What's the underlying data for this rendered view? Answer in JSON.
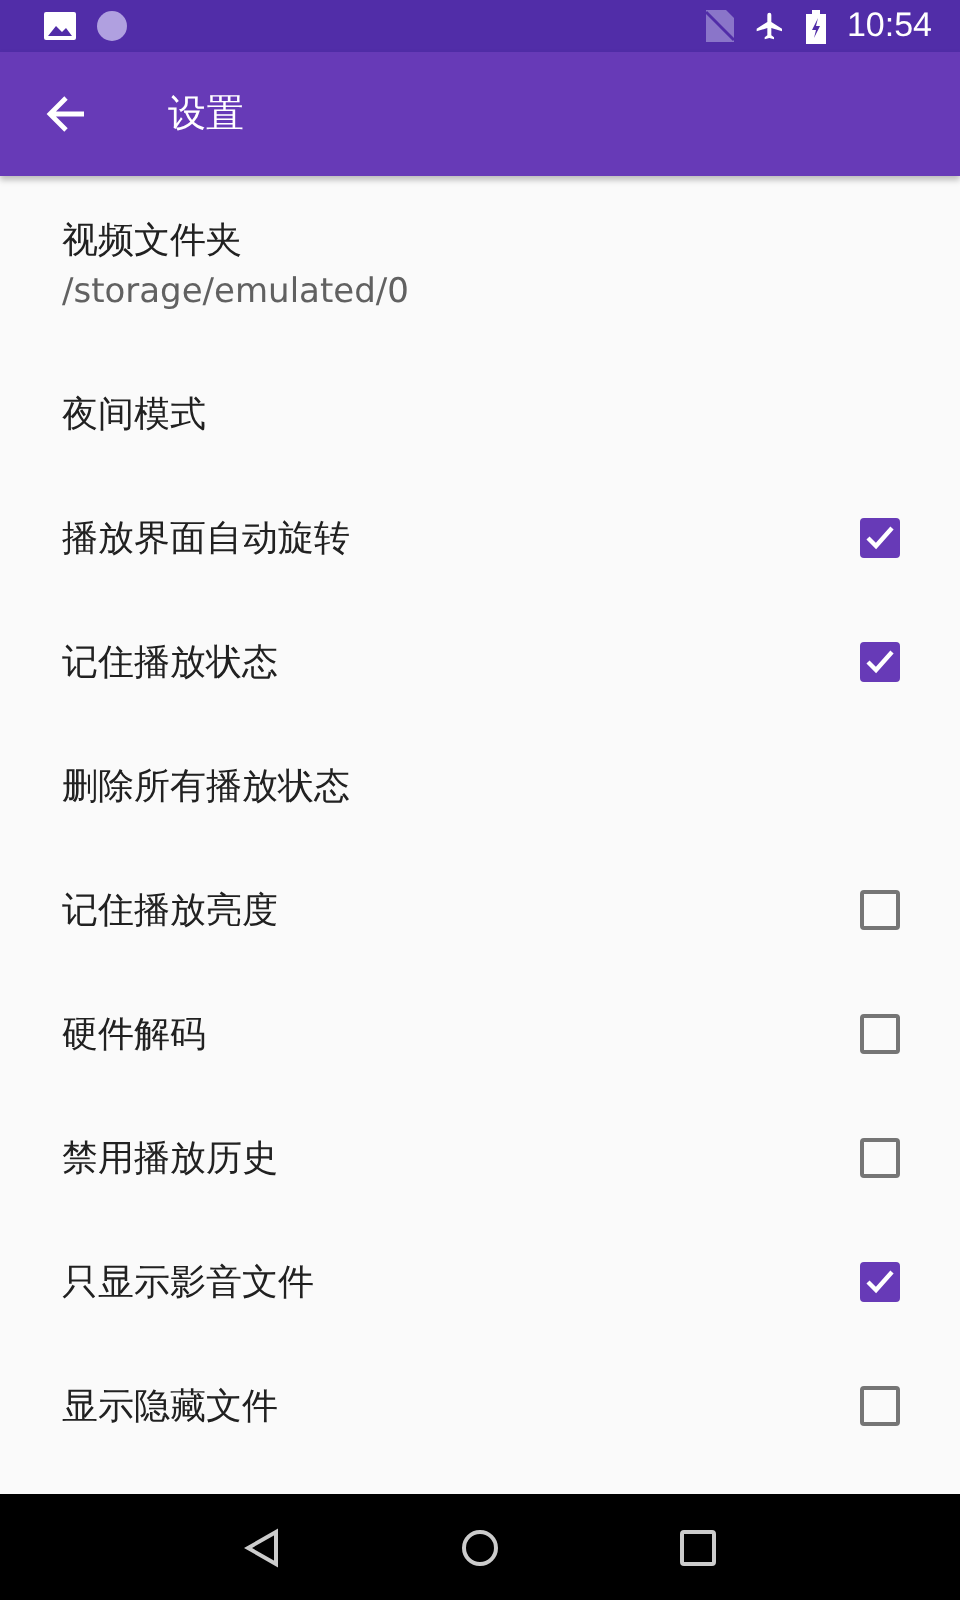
{
  "status_bar": {
    "time": "10:54"
  },
  "app_bar": {
    "title": "设置"
  },
  "settings": [
    {
      "kind": "text",
      "title": "视频文件夹",
      "summary": "/storage/emulated/0"
    },
    {
      "kind": "text",
      "title": "夜间模式"
    },
    {
      "kind": "checkbox",
      "title": "播放界面自动旋转",
      "checked": true
    },
    {
      "kind": "checkbox",
      "title": "记住播放状态",
      "checked": true
    },
    {
      "kind": "text",
      "title": "删除所有播放状态"
    },
    {
      "kind": "checkbox",
      "title": "记住播放亮度",
      "checked": false
    },
    {
      "kind": "checkbox",
      "title": "硬件解码",
      "checked": false
    },
    {
      "kind": "checkbox",
      "title": "禁用播放历史",
      "checked": false
    },
    {
      "kind": "checkbox",
      "title": "只显示影音文件",
      "checked": true
    },
    {
      "kind": "checkbox",
      "title": "显示隐藏文件",
      "checked": false
    }
  ]
}
